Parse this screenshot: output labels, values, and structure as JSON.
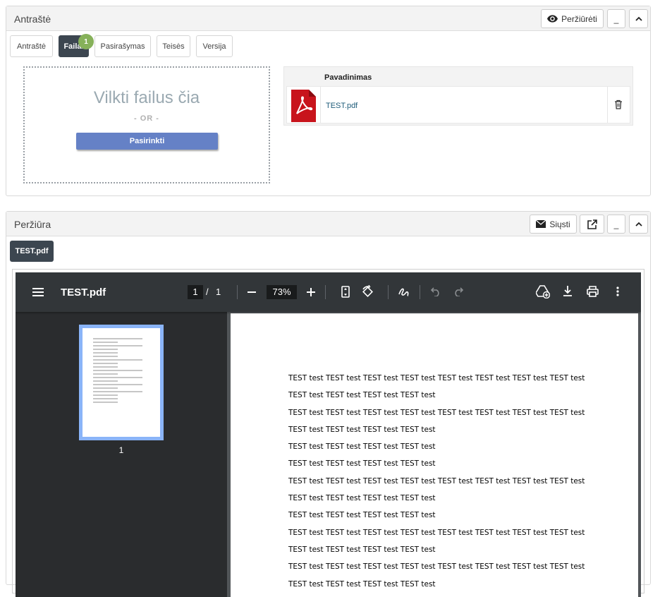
{
  "top_panel": {
    "title": "Antraštė",
    "preview_button": "Peržiūrėti",
    "minimize_label": "_",
    "tabs": [
      {
        "label": "Antraštė",
        "active": false
      },
      {
        "label": "Failai",
        "active": true
      },
      {
        "label": "Pasirašymas",
        "active": false
      },
      {
        "label": "Teisės",
        "active": false
      },
      {
        "label": "Versija",
        "active": false
      }
    ],
    "files_badge": "1",
    "dropzone": {
      "title": "Vilkti failus čia",
      "or": "- OR -",
      "button": "Pasirinkti"
    },
    "files_table": {
      "header": "Pavadinimas",
      "rows": [
        {
          "name": "TEST.pdf",
          "icon": "pdf-file-icon"
        }
      ]
    }
  },
  "bottom_panel": {
    "title": "Peržiūra",
    "send_button": "Siųsti",
    "minimize_label": "_",
    "document_tab": "TEST.pdf",
    "viewer": {
      "file_title": "TEST.pdf",
      "current_page": "1",
      "page_separator": "/",
      "total_pages": "1",
      "zoom": "73%",
      "thumbnail_label": "1",
      "content_lines": [
        "TEST test TEST test TEST test TEST test TEST test TEST test TEST test TEST test",
        "TEST test TEST test TEST test TEST test",
        "TEST test TEST test TEST test TEST test TEST test TEST test TEST test TEST test",
        "TEST test TEST test TEST test TEST test",
        "TEST test TEST test TEST test TEST test",
        "TEST test TEST test TEST test TEST test",
        "TEST test TEST test TEST test TEST test TEST test TEST test TEST test TEST test",
        "TEST test TEST test TEST test TEST test",
        "TEST test TEST test TEST test TEST test",
        "TEST test TEST test TEST test TEST test TEST test TEST test TEST test TEST test",
        "TEST test TEST test TEST test TEST test",
        "TEST test TEST test TEST test TEST test TEST test TEST test TEST test TEST test",
        "TEST test TEST test TEST test TEST test"
      ]
    }
  },
  "colors": {
    "accent_button": "#6581c6",
    "active_tab": "#3c4650",
    "badge": "#86b15a",
    "viewer_bg": "#323639",
    "thumb_border": "#8ab4f8"
  }
}
